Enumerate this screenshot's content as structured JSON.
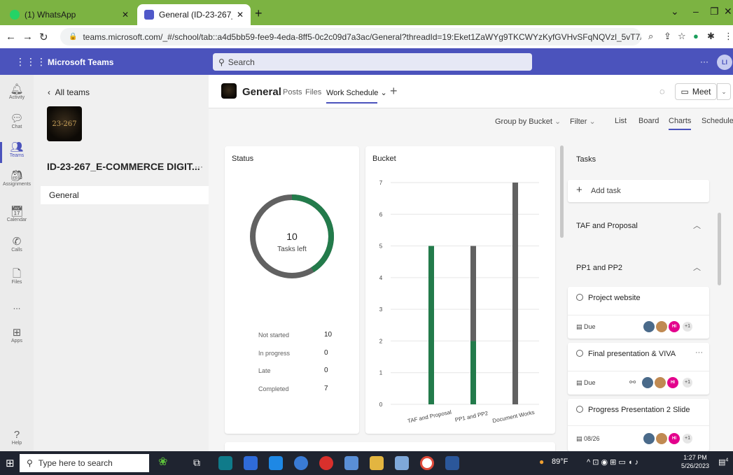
{
  "browser": {
    "tabs": [
      {
        "title": "(1) WhatsApp",
        "active": false
      },
      {
        "title": "General (ID-23-267_E-COMMER",
        "active": true
      }
    ],
    "url": "teams.microsoft.com/_#/school/tab::a4d5bb59-fee9-4eda-8ff5-0c2c09d7a3ac/General?threadId=19:Eket1ZaWYg9TKCWYzKyfGVHvSFqNQVzl_5vT7Armq..."
  },
  "teams": {
    "app_title": "Microsoft Teams",
    "search_placeholder": "Search",
    "me_initials": "LI"
  },
  "rail": [
    {
      "label": "Activity",
      "icon": "bell-icon"
    },
    {
      "label": "Chat",
      "icon": "chat-icon"
    },
    {
      "label": "Teams",
      "icon": "teams-icon",
      "active": true
    },
    {
      "label": "Assignments",
      "icon": "assignments-icon"
    },
    {
      "label": "Calendar",
      "icon": "calendar-icon"
    },
    {
      "label": "Calls",
      "icon": "phone-icon"
    },
    {
      "label": "Files",
      "icon": "file-icon"
    },
    {
      "label": "...",
      "icon": "more-icon"
    },
    {
      "label": "Apps",
      "icon": "apps-icon"
    },
    {
      "label": "Help",
      "icon": "help-icon"
    }
  ],
  "team_panel": {
    "all_teams": "All teams",
    "logo_text": "23-267",
    "team_name": "ID-23-267_E-COMMERCE DIGIT...",
    "channel": "General"
  },
  "channel_header": {
    "name": "General",
    "tabs": [
      "Posts",
      "Files",
      "Work Schedule"
    ],
    "meet_label": "Meet"
  },
  "toolbar": {
    "group_by": "Group by Bucket",
    "filter": "Filter",
    "views": [
      "List",
      "Board",
      "Charts",
      "Schedule"
    ],
    "selected_view": "Charts"
  },
  "status_card": {
    "title": "Status",
    "donut_value": "10",
    "donut_label": "Tasks left",
    "rows": [
      {
        "label": "Not started",
        "value": "10"
      },
      {
        "label": "In progress",
        "value": "0"
      },
      {
        "label": "Late",
        "value": "0"
      },
      {
        "label": "Completed",
        "value": "7"
      }
    ],
    "colors": {
      "not_started": "#616161",
      "completed": "#237b4b"
    }
  },
  "chart_data": {
    "type": "bar",
    "title": "Bucket",
    "categories": [
      "TAF and Proposal",
      "PP1 and PP2",
      "Document Works"
    ],
    "series": [
      {
        "name": "Not started",
        "values": [
          0,
          3,
          7
        ],
        "color": "#616161"
      },
      {
        "name": "Completed",
        "values": [
          5,
          2,
          0
        ],
        "color": "#237b4b"
      }
    ],
    "ylim": [
      0,
      7
    ],
    "yticks": [
      "0",
      "1",
      "2",
      "3",
      "4",
      "5",
      "6",
      "7"
    ],
    "grid": true
  },
  "tasks": {
    "title": "Tasks",
    "add_task": "Add task",
    "buckets": [
      {
        "name": "TAF and Proposal"
      },
      {
        "name": "PP1 and PP2"
      }
    ],
    "items": [
      {
        "title": "Project website",
        "due": "Due",
        "extra": "+1"
      },
      {
        "title": "Final presentation & VIVA",
        "due": "Due",
        "extra": "+1"
      },
      {
        "title": "Progress Presentation 2 Slide",
        "due": "08/26",
        "extra": "+1"
      }
    ],
    "hi_initials": "HI"
  },
  "taskbar": {
    "search_placeholder": "Type here to search",
    "weather": "89°F",
    "time": "1:27 PM",
    "date": "5/26/2023",
    "notif_count": "4"
  }
}
